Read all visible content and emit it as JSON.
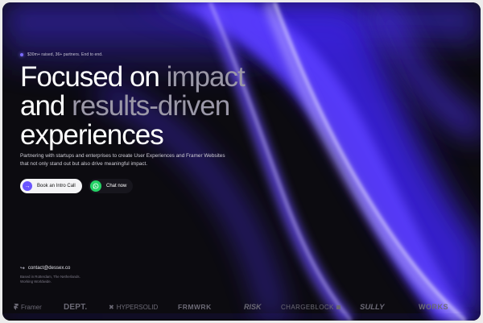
{
  "badge": {
    "text": "$30m+ raised, 36+ partners. End to end."
  },
  "hero": {
    "line1_white": "Focused on ",
    "line1_dim": "impact",
    "line2_white": "and ",
    "line2_dim": "results-driven",
    "line3_white": "experiences"
  },
  "subtitle": "Partnering with startups and enterprises to create User Experiences and Framer Websites that not only stand out but also drive meaningful impact.",
  "cta": {
    "primary_label": "Book an Intro Call",
    "chat_label": "Chat now"
  },
  "contact": {
    "email": "contact@dessex.co"
  },
  "location": "Based in Rotterdam, The Netherlands. Working Worldwide.",
  "logos": {
    "framer": "Framer",
    "dept": "DEPT.",
    "hypersolid": "HYPERSOLID",
    "frmwrk": "FRMWRK",
    "risk": "RISK",
    "chargeblock": "CHARGEBLOCK",
    "sully": "SULLY",
    "works": "WORKS"
  },
  "colors": {
    "accent": "#6a55ff",
    "background": "#0c0b10",
    "whatsapp": "#25d366"
  },
  "icons": [
    "arrow-right-icon",
    "whatsapp-icon",
    "arrow-return-icon",
    "framer-icon",
    "hypersolid-icon"
  ]
}
